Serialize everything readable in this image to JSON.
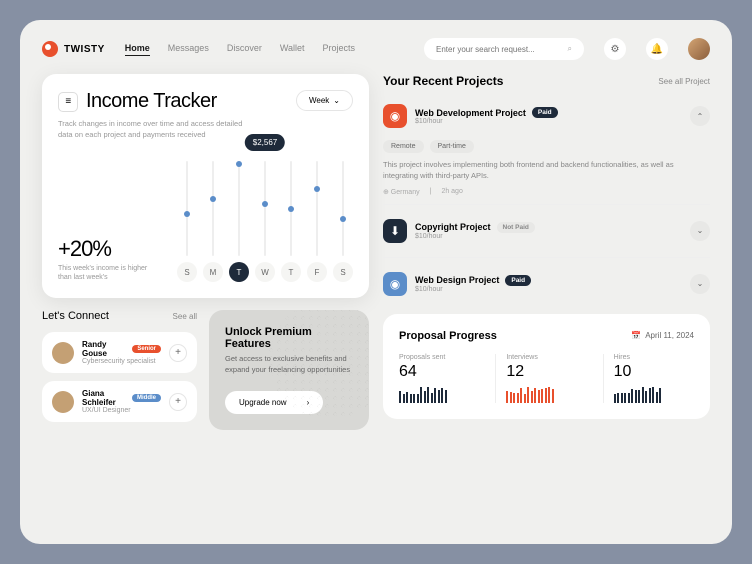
{
  "brand": "TWISTY",
  "nav": {
    "items": [
      "Home",
      "Messages",
      "Discover",
      "Wallet",
      "Projects"
    ],
    "active": 0
  },
  "search": {
    "placeholder": "Enter your search request..."
  },
  "income": {
    "title": "Income Tracker",
    "subtitle": "Track changes in income over time and access detailed data on each project and payments received",
    "period": "Week",
    "pct": "+20%",
    "pct_sub": "This week's income is higher than last week's",
    "tooltip": "$2,567"
  },
  "chart_data": {
    "type": "bar",
    "categories": [
      "S",
      "M",
      "T",
      "W",
      "T",
      "F",
      "S"
    ],
    "values": [
      45,
      60,
      95,
      55,
      50,
      70,
      40
    ],
    "highlight_index": 2,
    "highlight_value": "$2,567",
    "ylim": [
      0,
      100
    ]
  },
  "connect": {
    "title": "Let's Connect",
    "see_all": "See all",
    "people": [
      {
        "name": "Randy Gouse",
        "badge": "Senior",
        "badge_class": "senior",
        "role": "Cybersecurity specialist"
      },
      {
        "name": "Giana Schleifer",
        "badge": "Middle",
        "badge_class": "middle",
        "role": "UX/UI Designer"
      }
    ]
  },
  "premium": {
    "title": "Unlock Premium Features",
    "subtitle": "Get access to exclusive benefits and expand your freelancing opportunities",
    "cta": "Upgrade now"
  },
  "projects": {
    "title": "Your Recent Projects",
    "see_all": "See all Project",
    "items": [
      {
        "name": "Web Development Project",
        "rate": "$10/hour",
        "status": "Paid",
        "status_class": "paid",
        "icon_class": "orange",
        "expanded": true,
        "tags": [
          "Remote",
          "Part-time"
        ],
        "desc": "This project involves implementing both frontend and backend functionalities, as well as integrating with third-party APIs.",
        "location": "Germany",
        "time": "2h ago"
      },
      {
        "name": "Copyright Project",
        "rate": "$10/hour",
        "status": "Not Paid",
        "status_class": "notpaid",
        "icon_class": "dark"
      },
      {
        "name": "Web Design Project",
        "rate": "$10/hour",
        "status": "Paid",
        "status_class": "paid",
        "icon_class": "blue"
      }
    ]
  },
  "proposal": {
    "title": "Proposal Progress",
    "date": "April 11, 2024",
    "stats": [
      {
        "label": "Proposals sent",
        "value": "64",
        "color": "dark"
      },
      {
        "label": "Interviews",
        "value": "12",
        "color": "orange"
      },
      {
        "label": "Hires",
        "value": "10",
        "color": "dark"
      }
    ]
  }
}
